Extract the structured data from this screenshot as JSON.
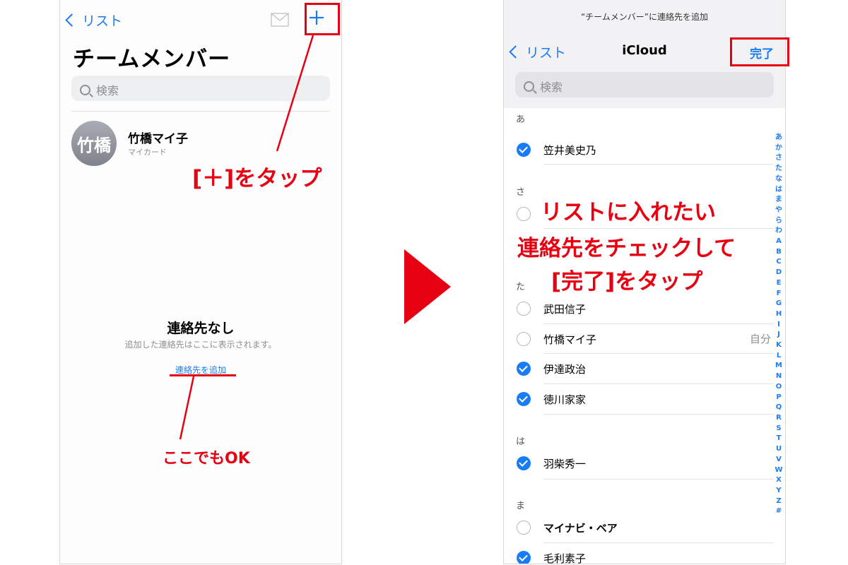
{
  "left": {
    "nav_back_label": "リスト",
    "title": "チームメンバー",
    "search_placeholder": "検索",
    "contact": {
      "avatar_text": "竹橋",
      "name": "竹橋マイ子",
      "subtitle": "マイカード"
    },
    "empty_title": "連絡先なし",
    "empty_desc": "追加した連絡先はここに表示されます。",
    "add_link": "連絡先を追加"
  },
  "right": {
    "sheet_title": "“チームメンバー”に連絡先を追加",
    "nav_back_label": "リスト",
    "nav_title": "iCloud",
    "done_label": "完了",
    "search_placeholder": "検索",
    "sections": [
      {
        "header": "あ",
        "rows": [
          {
            "name": "笠井美史乃",
            "checked": true
          }
        ]
      },
      {
        "header": "さ",
        "rows": [
          {
            "name": "",
            "checked": false
          }
        ]
      },
      {
        "header": "た",
        "rows": [
          {
            "name": "武田信子",
            "checked": false
          },
          {
            "name": "竹橋マイ子",
            "checked": false,
            "tag": "自分"
          },
          {
            "name": "伊達政治",
            "checked": true
          },
          {
            "name": "徳川家家",
            "checked": true
          }
        ]
      },
      {
        "header": "は",
        "rows": [
          {
            "name": "羽柴秀一",
            "checked": true
          }
        ]
      },
      {
        "header": "ま",
        "rows": [
          {
            "name": "マイナビ・ベア",
            "checked": false
          },
          {
            "name": "毛利素子",
            "checked": true
          }
        ]
      }
    ],
    "index": [
      "あ",
      "か",
      "さ",
      "た",
      "な",
      "は",
      "ま",
      "や",
      "ら",
      "わ",
      "A",
      "B",
      "C",
      "D",
      "E",
      "F",
      "G",
      "H",
      "I",
      "J",
      "K",
      "L",
      "M",
      "N",
      "O",
      "P",
      "Q",
      "R",
      "S",
      "T",
      "U",
      "V",
      "W",
      "X",
      "Y",
      "Z",
      "#"
    ]
  },
  "annotations": {
    "tap_plus": "[＋]をタップ",
    "here_ok": "ここでもOK",
    "right_line1": "リストに入れたい",
    "right_line2": "連絡先をチェックして",
    "right_line3": "[完了]をタップ"
  },
  "colors": {
    "accent": "#1a7cf5",
    "annotation": "#e60012"
  },
  "icons": {
    "mail": "mail-icon",
    "plus": "plus-icon",
    "arrow": "next-arrow-icon"
  }
}
